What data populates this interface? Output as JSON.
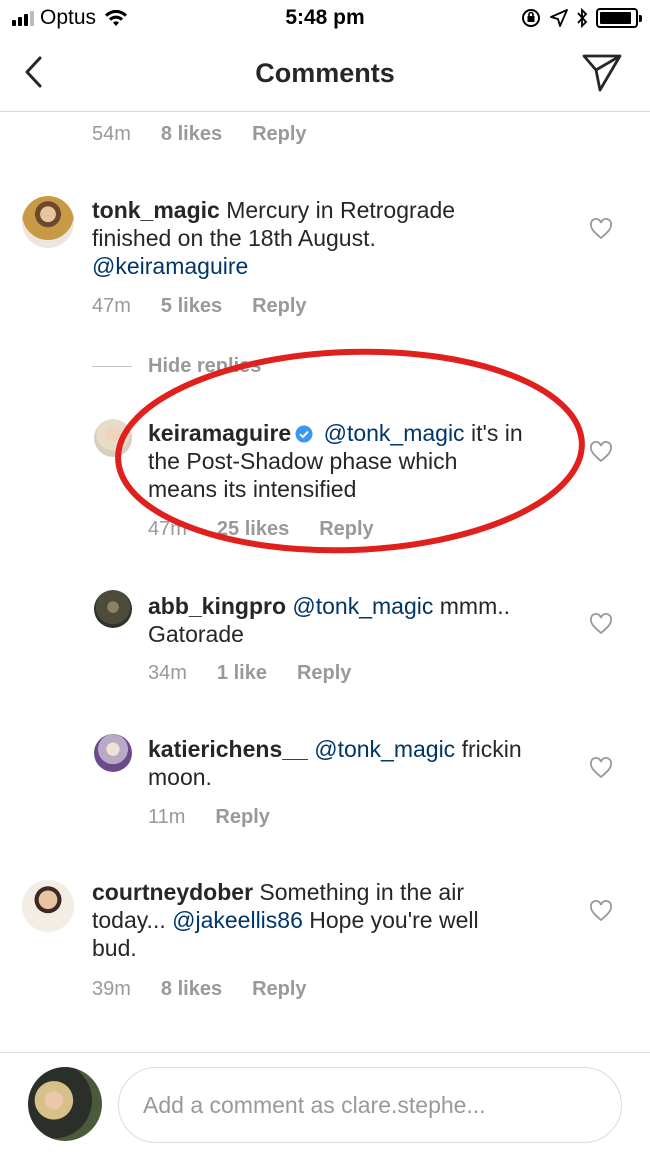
{
  "status_bar": {
    "carrier": "Optus",
    "time": "5:48 pm"
  },
  "nav": {
    "title": "Comments"
  },
  "top_meta": {
    "time": "54m",
    "likes": "8 likes",
    "reply": "Reply"
  },
  "comments": [
    {
      "username": "tonk_magic",
      "text_a": " Mercury in Retrograde",
      "text_b": "finished on the 18th August.",
      "mention": "@keiramaguire",
      "time": "47m",
      "likes": "5 likes",
      "reply": "Reply"
    },
    {
      "username": "katierichens__",
      "mention": "@tonk_magic",
      "text_a": " frickin",
      "text_b": "moon.",
      "time": "11m",
      "reply": "Reply"
    },
    {
      "username": "courtneydober",
      "text_a": " Something in the air",
      "text_b": "today... ",
      "mention": "@jakeellis86",
      "text_c": " Hope you're well",
      "text_d": "bud.",
      "time": "39m",
      "likes": "8 likes",
      "reply": "Reply"
    }
  ],
  "hide_replies": "Hide replies",
  "replies": [
    {
      "username": "keiramaguire",
      "mention": "@tonk_magic",
      "text_a": " it's in",
      "text_b": "the Post-Shadow phase which",
      "text_c": "means its intensified",
      "time": "47m",
      "likes": "25 likes",
      "reply": "Reply"
    },
    {
      "username": "abb_kingpro",
      "mention": "@tonk_magic",
      "text_a": " mmm..",
      "text_b": "Gatorade",
      "time": "34m",
      "likes": "1 like",
      "reply": "Reply"
    }
  ],
  "input": {
    "placeholder": "Add a comment as clare.stephe..."
  },
  "colors": {
    "mention": "#003569",
    "meta": "#999999",
    "annotation": "#e0201c"
  }
}
